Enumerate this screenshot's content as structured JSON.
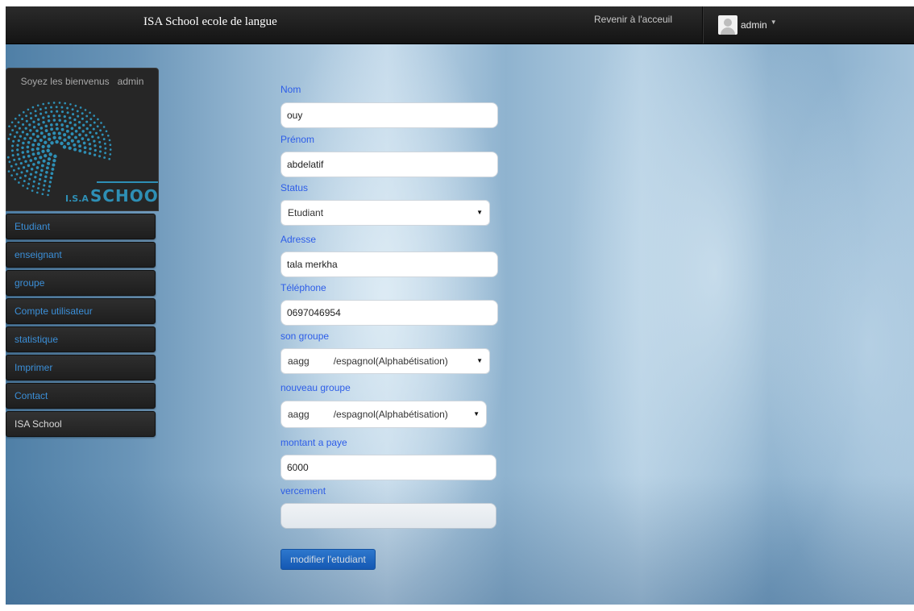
{
  "navbar": {
    "brand": "ISA School ecole de langue",
    "home_link": "Revenir à l'acceuil",
    "user": "admin",
    "caret_icon": "chevron-down-icon",
    "avatar_icon": "user-avatar-icon"
  },
  "sidebar": {
    "welcome": "Soyez les bienvenus   admin",
    "logo_text": "SCHOOL",
    "logo_prefix": "I.S.A",
    "items": [
      {
        "label": "Etudiant"
      },
      {
        "label": "enseignant"
      },
      {
        "label": "groupe"
      },
      {
        "label": "Compte utilisateur"
      },
      {
        "label": "statistique"
      },
      {
        "label": "Imprimer"
      },
      {
        "label": "Contact"
      },
      {
        "label": "ISA School"
      }
    ]
  },
  "form": {
    "nom": {
      "label": "Nom",
      "value": "ouy"
    },
    "prenom": {
      "label": "Prénom",
      "value": "abdelatif"
    },
    "status": {
      "label": "Status",
      "value": "Etudiant"
    },
    "adresse": {
      "label": "Adresse",
      "value": "tala merkha"
    },
    "telephone": {
      "label": "Téléphone",
      "value": "0697046954"
    },
    "son_groupe": {
      "label": "son groupe",
      "value": "aagg         /espagnol(Alphabétisation)"
    },
    "nouveau_groupe": {
      "label": "nouveau groupe",
      "value": "aagg         /espagnol(Alphabétisation)"
    },
    "montant": {
      "label": "montant a paye",
      "value": "6000"
    },
    "vercement": {
      "label": "vercement",
      "value": ""
    },
    "submit": "modifier l'etudiant"
  },
  "colors": {
    "accent": "#2d5de8",
    "navbar": "#1a1a1a",
    "button": "#0b58c4",
    "sidebar_link": "#3b8fd8"
  }
}
